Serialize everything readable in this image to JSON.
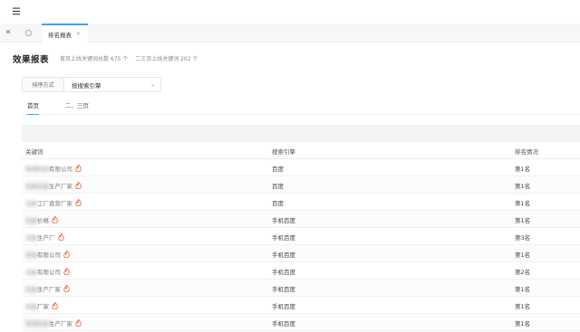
{
  "tabbar": {
    "active_tab": "排名报表",
    "close": "×",
    "collapse": "«"
  },
  "header": {
    "title": "效果报表",
    "summary_1": "首页上线关键词总数 675 个",
    "summary_2": "二三页上线关键词 202 个"
  },
  "sort": {
    "label": "排序方式",
    "value": "按搜索引擎",
    "caret": "⌄"
  },
  "page_tabs": [
    {
      "label": "首页",
      "active": true
    },
    {
      "label": "二、三页",
      "active": false
    }
  ],
  "table": {
    "columns": [
      "关键词",
      "搜索引擎",
      "排名情况"
    ],
    "rows": [
      {
        "keyword_blur": "聚通机械",
        "keyword": "有限公司",
        "engine": "百度",
        "rank": "第1名"
      },
      {
        "keyword_blur": "机器设备",
        "keyword": "生产厂家",
        "engine": "百度",
        "rank": "第1名"
      },
      {
        "keyword_blur": "设备",
        "keyword": "工厂直营厂家",
        "engine": "百度",
        "rank": "第1名"
      },
      {
        "keyword_blur": "机器",
        "keyword": "价格",
        "engine": "手机百度",
        "rank": "第1名"
      },
      {
        "keyword_blur": "设备",
        "keyword": "生产厂",
        "engine": "手机百度",
        "rank": "第3名"
      },
      {
        "keyword_blur": "机械",
        "keyword": "有限公司",
        "engine": "手机百度",
        "rank": "第1名"
      },
      {
        "keyword_blur": "设备",
        "keyword": "有限公司",
        "engine": "手机百度",
        "rank": "第2名"
      },
      {
        "keyword_blur": "机器",
        "keyword": "生产厂家",
        "engine": "手机百度",
        "rank": "第1名"
      },
      {
        "keyword_blur": "机器",
        "keyword": "厂家",
        "engine": "手机百度",
        "rank": "第1名"
      },
      {
        "keyword_blur": "聚通机械",
        "keyword": "生产厂家",
        "engine": "手机百度",
        "rank": "第1名"
      }
    ]
  },
  "colors": {
    "accent": "#409eff",
    "fire": "#e8613c"
  },
  "icons": {
    "menu": "menu-icon",
    "collapse": "double-chevron-left-icon",
    "refresh": "refresh-icon",
    "fire": "fire-icon"
  }
}
